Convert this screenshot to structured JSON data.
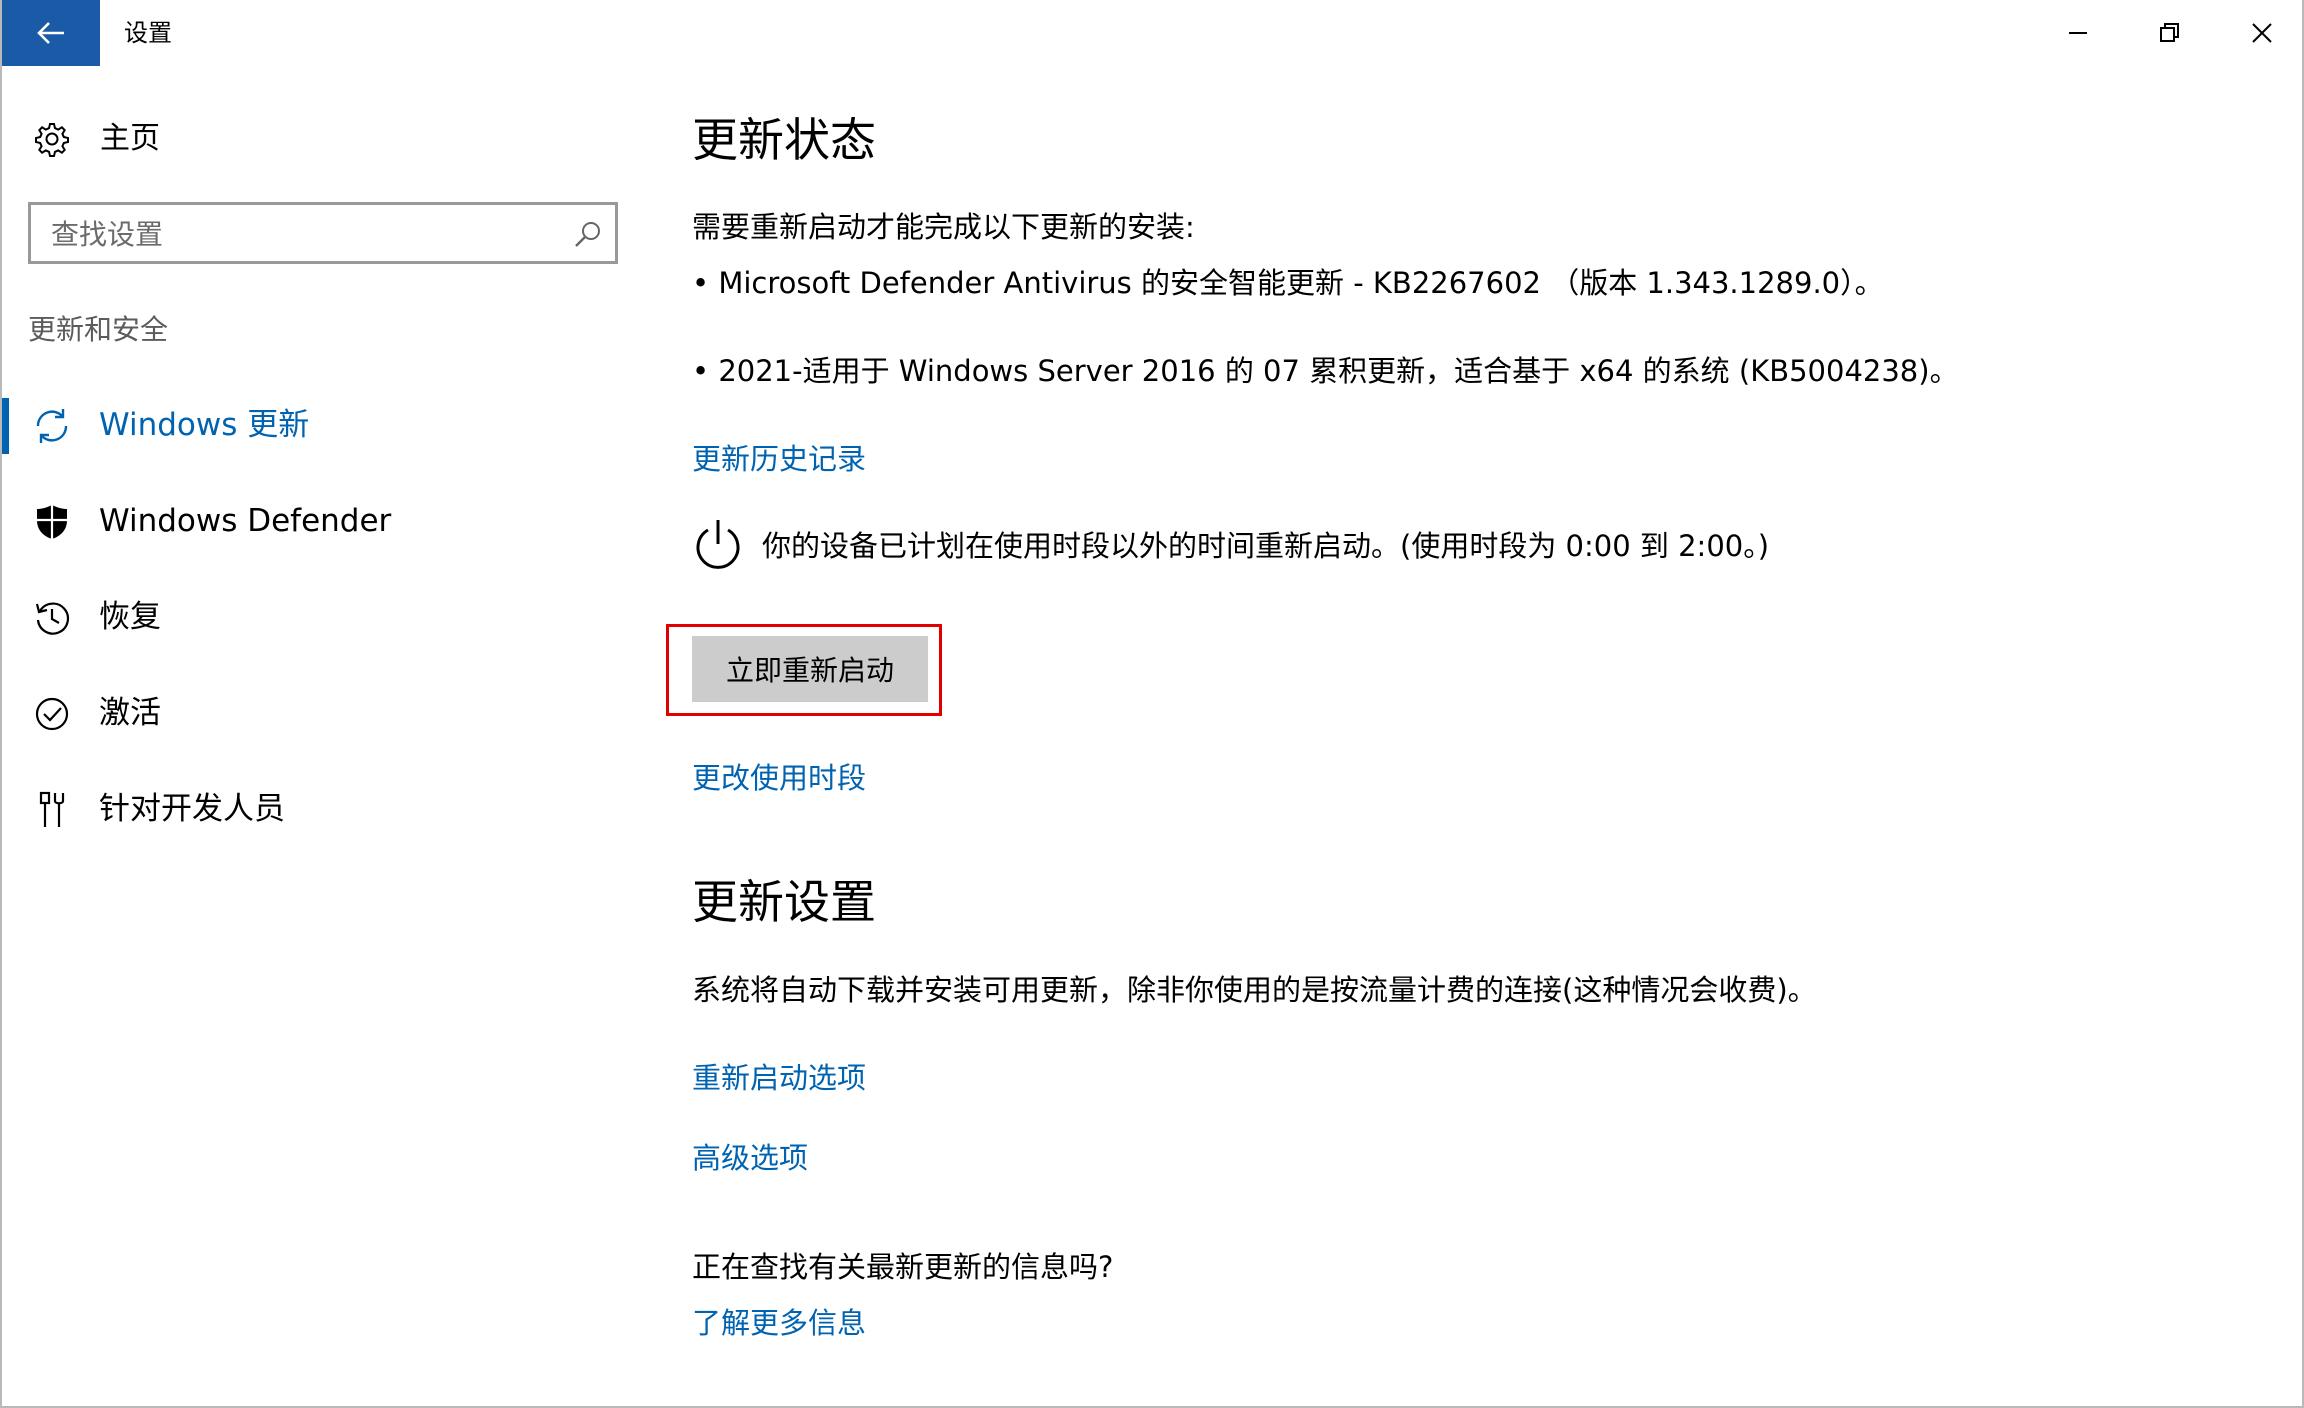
{
  "window": {
    "title": "设置",
    "accent_color": "#1a5aa6",
    "back_icon": "arrow-left-icon",
    "minimize_icon": "minimize-icon",
    "maximize_icon": "restore-icon",
    "close_icon": "close-icon"
  },
  "sidebar": {
    "home_label": "主页",
    "home_icon": "gear-icon",
    "search_placeholder": "查找设置",
    "section_label": "更新和安全",
    "items": [
      {
        "label": "Windows 更新",
        "icon": "sync-icon",
        "active": true
      },
      {
        "label": "Windows Defender",
        "icon": "shield-icon",
        "active": false
      },
      {
        "label": "恢复",
        "icon": "history-icon",
        "active": false
      },
      {
        "label": "激活",
        "icon": "check-circle-icon",
        "active": false
      },
      {
        "label": "针对开发人员",
        "icon": "developer-tools-icon",
        "active": false
      }
    ],
    "active_color": "#0063b1"
  },
  "main": {
    "update_status": {
      "heading": "更新状态",
      "intro": "需要重新启动才能完成以下更新的安装:",
      "updates": [
        "• Microsoft Defender Antivirus 的安全智能更新 - KB2267602 （版本 1.343.1289.0）。",
        "• 2021-适用于 Windows Server 2016 的 07 累积更新，适合基于 x64 的系统 (KB5004238)。"
      ],
      "history_link": "更新历史记录",
      "restart_notice": "你的设备已计划在使用时段以外的时间重新启动。(使用时段为 0:00 到 2:00。)",
      "restart_notice_icon": "power-icon",
      "restart_button": "立即重新启动",
      "active_hours_link": "更改使用时段"
    },
    "update_settings": {
      "heading": "更新设置",
      "description": "系统将自动下载并安装可用更新，除非你使用的是按流量计费的连接(这种情况会收费)。",
      "restart_options_link": "重新启动选项",
      "advanced_options_link": "高级选项"
    },
    "info": {
      "question": "正在查找有关最新更新的信息吗?",
      "learn_more_link": "了解更多信息"
    },
    "link_color": "#0063b1",
    "highlight_color": "#e00000"
  }
}
